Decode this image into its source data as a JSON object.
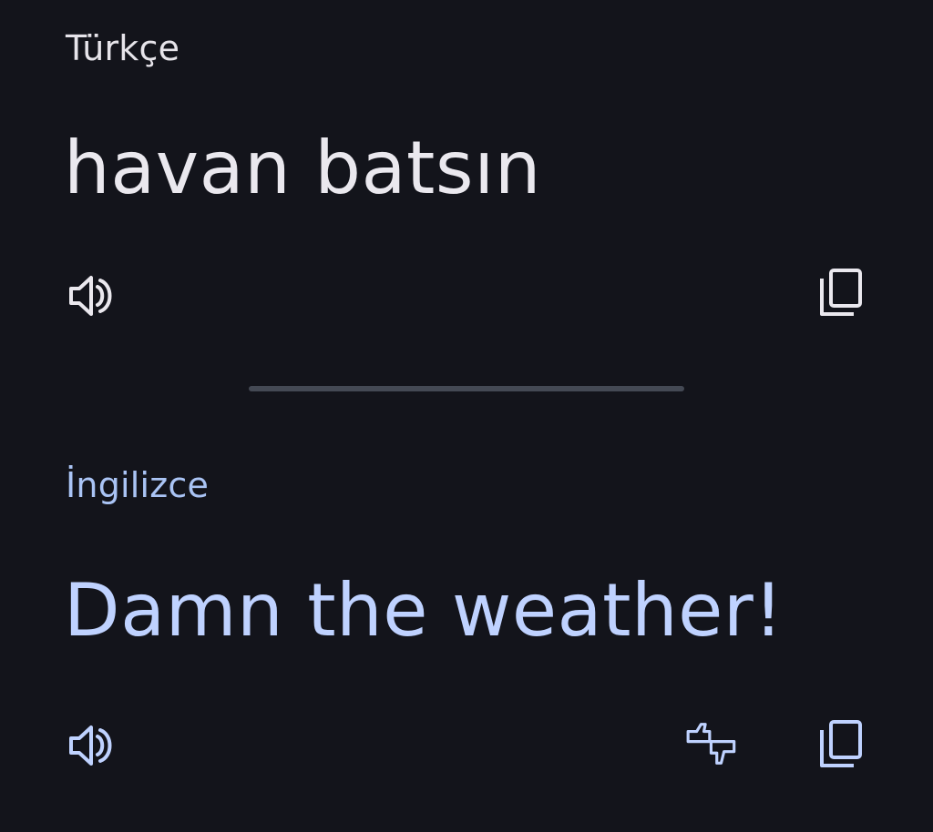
{
  "source": {
    "language": "Türkçe",
    "text": "havan batsın",
    "icons": {
      "speak": "speaker-icon",
      "copy": "copy-icon"
    }
  },
  "translation": {
    "language": "İngilizce",
    "text": "Damn the weather!",
    "icons": {
      "speak": "speaker-icon",
      "feedback": "feedback-icon",
      "copy": "copy-icon"
    }
  },
  "colors": {
    "background": "#13141b",
    "source_text": "#eae8ee",
    "translation_text": "#bfd2ff",
    "divider": "#444954"
  }
}
